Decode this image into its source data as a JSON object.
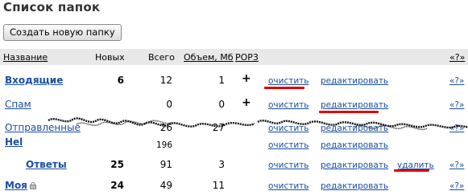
{
  "page": {
    "title": "Список папок"
  },
  "toolbar": {
    "create_label": "Создать новую папку"
  },
  "header": {
    "name": "Название",
    "new": "Новых",
    "total": "Всего",
    "size": "Объем, Мб",
    "pop3": "POP3",
    "move": "«?»"
  },
  "rows": [
    {
      "name": "Входящие",
      "new": "6",
      "total": "12",
      "size": "1",
      "pop3": "+",
      "clear": "очистить",
      "edit": "редактировать",
      "delete": "",
      "move": "«?»"
    },
    {
      "name": "Спам",
      "new": "",
      "total": "0",
      "size": "0",
      "pop3": "+",
      "clear": "очистить",
      "edit": "редактировать",
      "delete": "",
      "move": "«?»"
    },
    {
      "name": "Отправленные",
      "new": "",
      "total": "26",
      "size": "27",
      "pop3": "",
      "clear": "очистить",
      "edit": "редактировать",
      "delete": "",
      "move": "«?»"
    },
    {
      "name": "Hel",
      "new": "",
      "total": "196",
      "size": "",
      "pop3": "",
      "clear": "очистить",
      "edit": "редактировать",
      "delete": "",
      "move": ""
    },
    {
      "name": "Ответы",
      "new": "25",
      "total": "91",
      "size": "3",
      "pop3": "",
      "clear": "очистить",
      "edit": "редактировать",
      "delete": "удалить",
      "move": "«?»"
    },
    {
      "name": "Моя",
      "new": "24",
      "total": "49",
      "size": "11",
      "pop3": "",
      "clear": "очистить",
      "edit": "редактировать",
      "delete": "",
      "move": "«?»"
    }
  ],
  "colors": {
    "link": "#1a4fa3",
    "highlight": "#e00000",
    "header_bg": "#e8e8e8"
  }
}
